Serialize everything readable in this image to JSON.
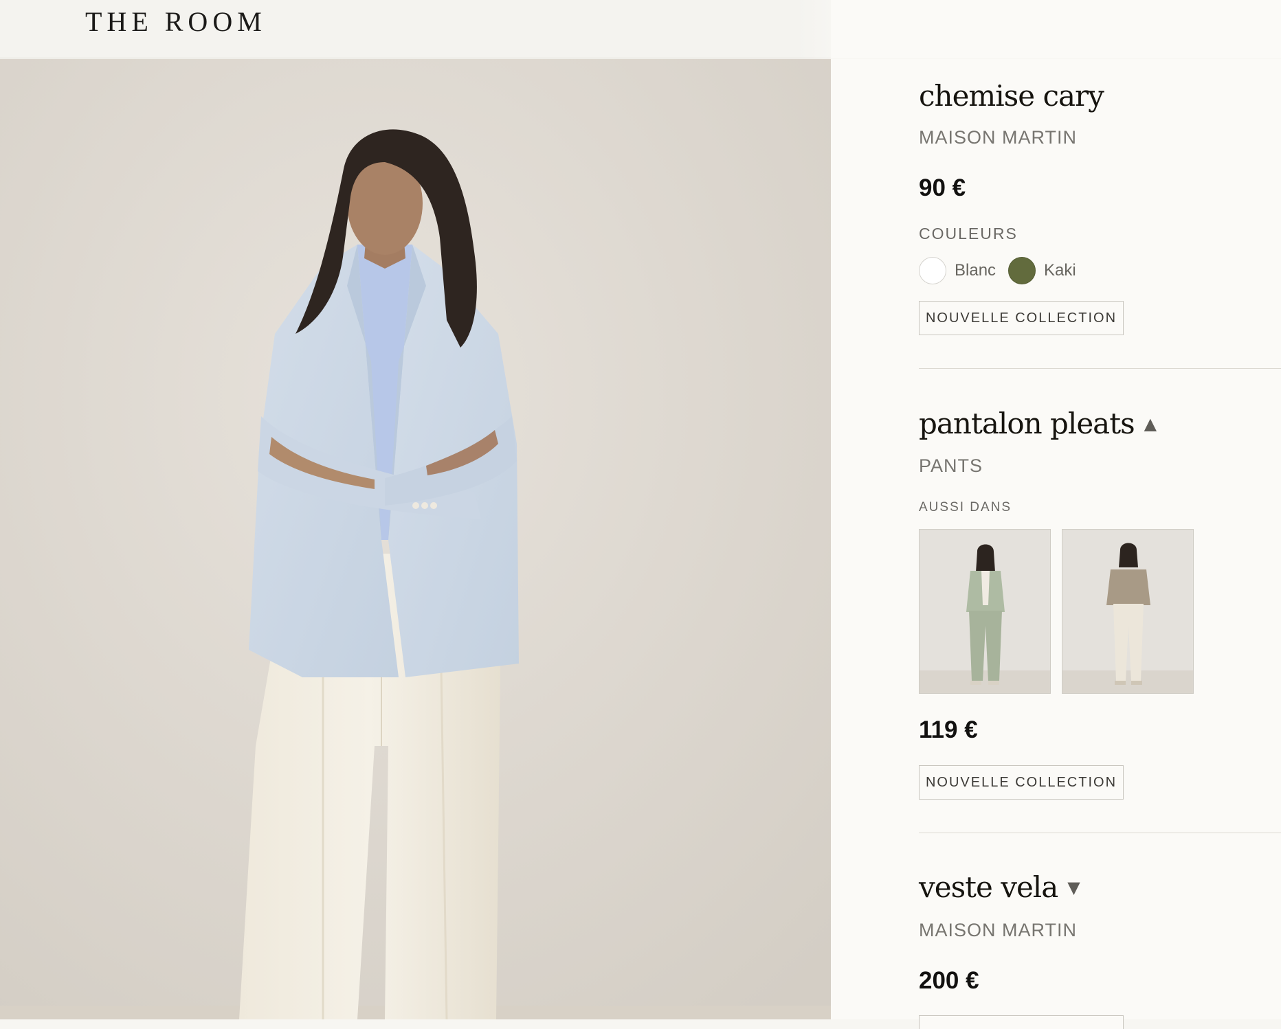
{
  "header": {
    "logo": "THE ROOM"
  },
  "hero": {
    "image_subject": "model-in-light-blue-blazer-and-cream-trousers"
  },
  "products": [
    {
      "name": "chemise cary",
      "brand": "MAISON MARTIN",
      "price": "90 €",
      "colors_label": "COULEURS",
      "colors": [
        {
          "name": "Blanc",
          "hex": "#ffffff"
        },
        {
          "name": "Kaki",
          "hex": "#626b3d"
        }
      ],
      "badge": "NOUVELLE COLLECTION"
    },
    {
      "name": "pantalon pleats",
      "caret": "▲",
      "brand": "PANTS",
      "also_in_label": "AUSSI DANS",
      "also_in": [
        {
          "subject": "sage-green-suit-look"
        },
        {
          "subject": "taupe-blouse-cream-pants-look"
        }
      ],
      "price": "119 €",
      "badge": "NOUVELLE COLLECTION"
    },
    {
      "name": "veste vela",
      "caret": "▼",
      "brand": "MAISON MARTIN",
      "price": "200 €"
    }
  ],
  "colors": {
    "page_bg": "#fbfaf7",
    "header_bg": "#f4f3ef",
    "text": "#16140f",
    "muted": "#777570",
    "divider": "#dcd9d2"
  }
}
